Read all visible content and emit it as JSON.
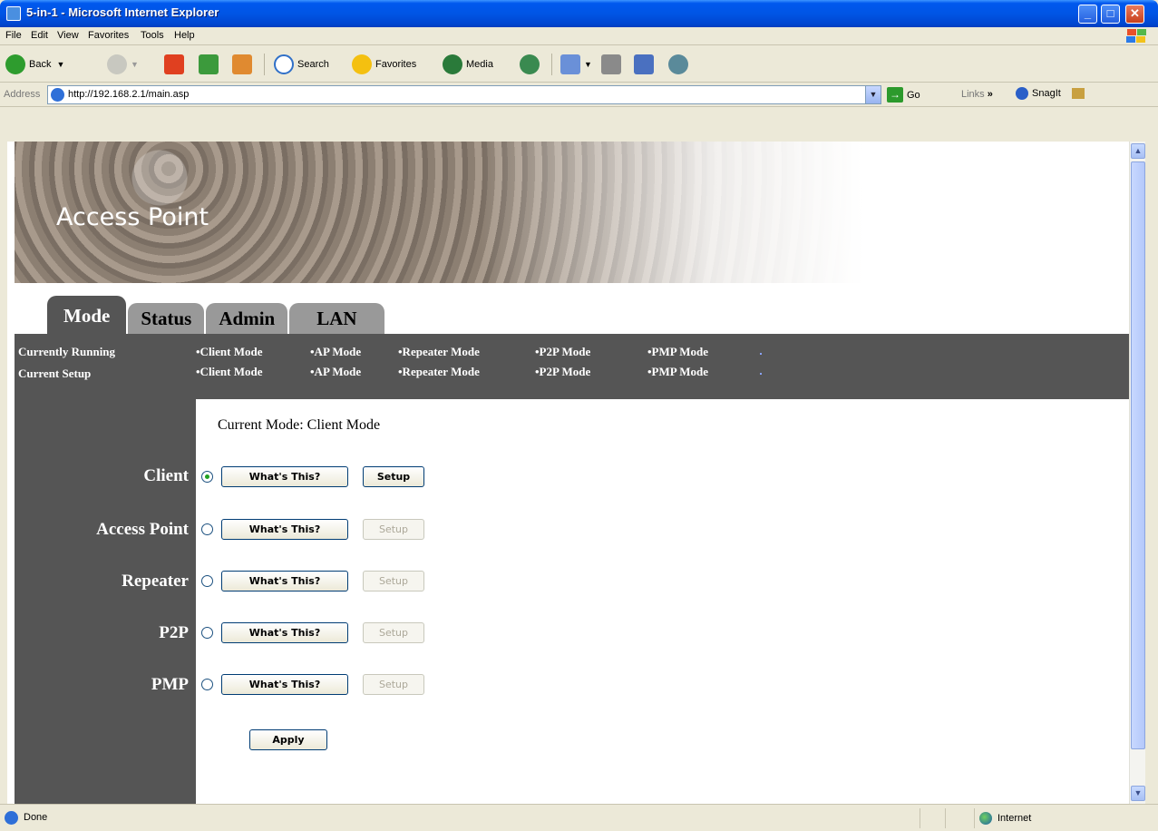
{
  "window": {
    "title": "5-in-1 - Microsoft Internet Explorer"
  },
  "menu": [
    "File",
    "Edit",
    "View",
    "Favorites",
    "Tools",
    "Help"
  ],
  "toolbar": {
    "back": "Back",
    "search": "Search",
    "favorites": "Favorites",
    "media": "Media"
  },
  "address": {
    "label": "Address",
    "url": "http://192.168.2.1/main.asp",
    "go": "Go",
    "links": "Links",
    "snagit": "SnagIt"
  },
  "banner": {
    "title": "Access Point"
  },
  "tabs": [
    "Mode",
    "Status",
    "Admin",
    "LAN"
  ],
  "status_strip": {
    "rows": [
      {
        "label": "Currently Running",
        "modes": [
          "•Client Mode",
          "•AP Mode",
          "•Repeater Mode",
          "•P2P Mode",
          "•PMP Mode"
        ]
      },
      {
        "label": "Current Setup",
        "modes": [
          "•Client Mode",
          "•AP Mode",
          "•Repeater Mode",
          "•P2P Mode",
          "•PMP Mode"
        ]
      }
    ]
  },
  "main": {
    "current_mode": "Current Mode: Client Mode",
    "whats_this_label": "What's This?",
    "setup_label": "Setup",
    "apply_label": "Apply",
    "modes": [
      {
        "label": "Client",
        "selected": true,
        "setup_enabled": true
      },
      {
        "label": "Access Point",
        "selected": false,
        "setup_enabled": false
      },
      {
        "label": "Repeater",
        "selected": false,
        "setup_enabled": false
      },
      {
        "label": "P2P",
        "selected": false,
        "setup_enabled": false
      },
      {
        "label": "PMP",
        "selected": false,
        "setup_enabled": false
      }
    ]
  },
  "statusbar": {
    "left": "Done",
    "zone": "Internet"
  }
}
